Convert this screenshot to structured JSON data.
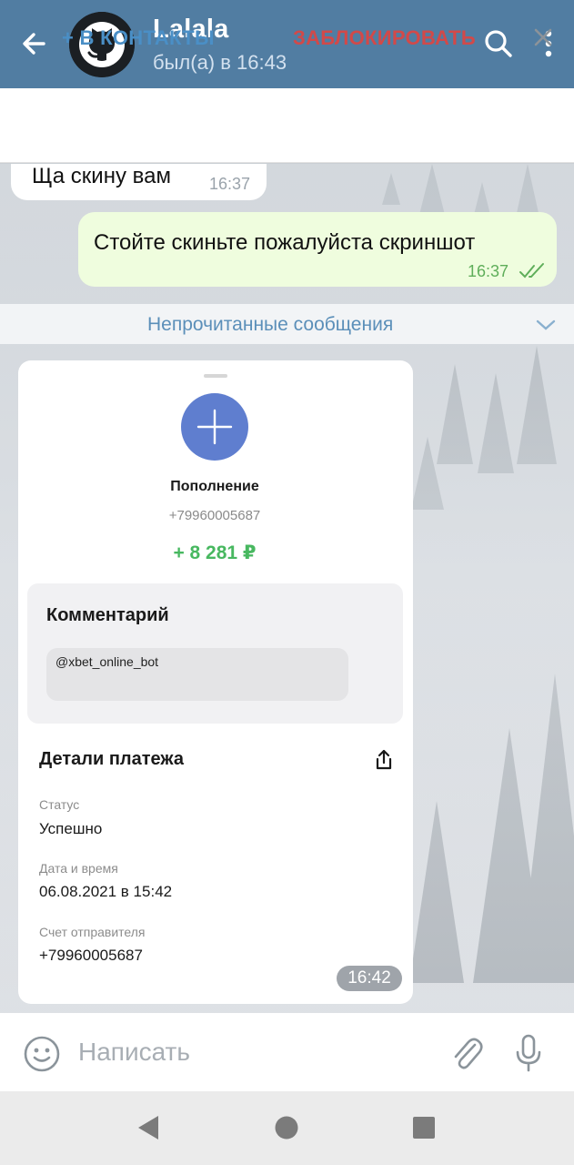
{
  "header": {
    "title": "Lalala",
    "status": "был(а) в 16:43",
    "icons": [
      "back-arrow-icon",
      "github-avatar",
      "search-icon",
      "more-vert-icon"
    ]
  },
  "action_bar": {
    "add_contact": "+ В КОНТАКТЫ",
    "block": "ЗАБЛОКИРОВАТЬ"
  },
  "messages": [
    {
      "direction": "in",
      "text": "Ща скину вам",
      "time": "16:37"
    },
    {
      "direction": "out",
      "text": "Стойте скиньте пожалуйста скриншот",
      "time": "16:37",
      "read": true
    }
  ],
  "unread_divider": "Непрочитанные сообщения",
  "image_message": {
    "time": "16:42",
    "receipt": {
      "title": "Пополнение",
      "phone": "+79960005687",
      "amount": "+ 8 281 ₽",
      "comment_title": "Комментарий",
      "comment_value": "@xbet_online_bot",
      "details_title": "Детали платежа",
      "fields": [
        {
          "label": "Статус",
          "value": "Успешно"
        },
        {
          "label": "Дата и время",
          "value": "06.08.2021 в 15:42"
        },
        {
          "label": "Счет отправителя",
          "value": "+79960005687"
        }
      ]
    }
  },
  "input": {
    "placeholder": "Написать"
  },
  "colors": {
    "header": "#517da2",
    "add_contact": "#4a8fc6",
    "block": "#d24949",
    "outgoing_bubble": "#effdde",
    "amount": "#48b860",
    "plus_circle": "#5f7ecf"
  }
}
